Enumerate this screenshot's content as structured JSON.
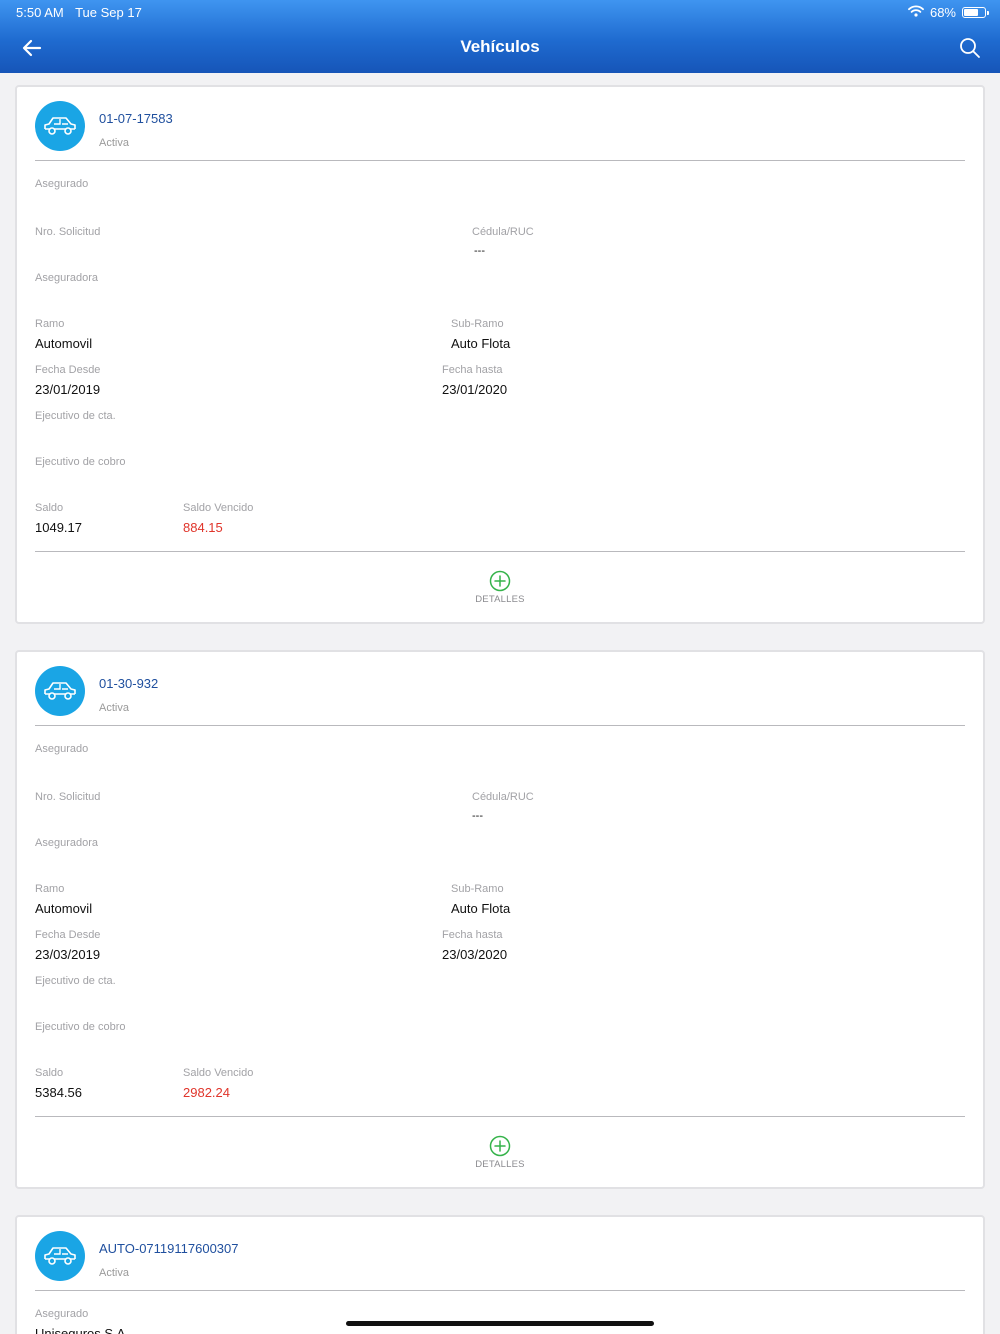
{
  "status_bar": {
    "time": "5:50 AM",
    "date": "Tue Sep 17",
    "battery": "68%",
    "battery_level": 0.68
  },
  "nav": {
    "title": "Vehículos"
  },
  "labels": {
    "asegurado": "Asegurado",
    "nro_solicitud": "Nro. Solicitud",
    "cedula_ruc": "Cédula/RUC",
    "aseguradora": "Aseguradora",
    "ramo": "Ramo",
    "sub_ramo": "Sub-Ramo",
    "fecha_desde": "Fecha Desde",
    "fecha_hasta": "Fecha hasta",
    "ejecutivo_cta": "Ejecutivo de cta.",
    "ejecutivo_cobro": "Ejecutivo de cobro",
    "saldo": "Saldo",
    "saldo_vencido": "Saldo Vencido",
    "detalles": "DETALLES"
  },
  "policies": [
    {
      "number": "01-07-17583",
      "status": "Activa",
      "asegurado": "",
      "cedula_ruc": "---",
      "ramo": "Automovil",
      "sub_ramo": "Auto Flota",
      "fecha_desde": "23/01/2019",
      "fecha_hasta": "23/01/2020",
      "saldo": "1049.17",
      "saldo_vencido": "884.15"
    },
    {
      "number": "01-30-932",
      "status": "Activa",
      "asegurado": "",
      "cedula_ruc": "---",
      "ramo": "Automovil",
      "sub_ramo": "Auto Flota",
      "fecha_desde": "23/03/2019",
      "fecha_hasta": "23/03/2020",
      "saldo": "5384.56",
      "saldo_vencido": "2982.24"
    },
    {
      "number": "AUTO-07119117600307",
      "status": "Activa",
      "asegurado": "Uniseguros S.A."
    }
  ]
}
